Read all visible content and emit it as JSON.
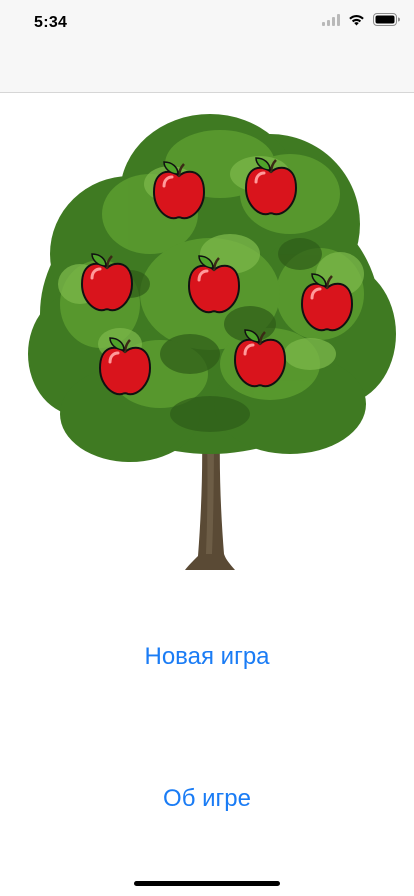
{
  "status_bar": {
    "time": "5:34",
    "icons": [
      "cellular-signal-icon",
      "wifi-icon",
      "battery-icon"
    ]
  },
  "scene": {
    "illustration": "tree-icon",
    "apple_icon": "apple-icon",
    "apple_count": 7
  },
  "menu": {
    "new_game_label": "Новая игра",
    "about_label": "Об игре"
  },
  "colors": {
    "accent": "#1a7cf5",
    "apple_red": "#d9141c",
    "leaf_green": "#3f8a1f",
    "bar_background": "#f7f7f7"
  }
}
